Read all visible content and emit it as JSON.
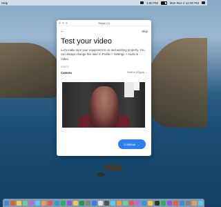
{
  "menubar": {
    "app_name": "Help",
    "status_text": "1:00 PM",
    "clock": "Mon Nov 2 12:00 PM"
  },
  "window": {
    "title": "Skype (1)",
    "skip_label": "Skip",
    "back_icon": "arrow-left-icon",
    "heading": "Test your video",
    "description": "Let's make sure your equipment is on and working properly. You can always change this later in Profile > Settings > Audio & Video.",
    "section_label": "VIDEO",
    "camera_label": "Camera",
    "camera_value": "Built-in (iSight)",
    "continue_label": "Continue",
    "continue_icon": "arrow-right-icon",
    "accent_color": "#2f7ff0"
  },
  "dock": {
    "icon_colors": [
      "#3a8ee6",
      "#e85d3a",
      "#f2c94c",
      "#6fcf97",
      "#bb6bd9",
      "#56ccf2",
      "#f2994a",
      "#eb5757",
      "#2d9cdb",
      "#27ae60",
      "#9b51e0",
      "#f2c94c",
      "#219653",
      "#828282",
      "#2f80ed",
      "#e0e0e0",
      "#4f4f4f",
      "#56ccf2",
      "#f2994a",
      "#6fcf97",
      "#eb5757",
      "#bb6bd9",
      "#2d9cdb",
      "#f2c94c",
      "#333333",
      "#27ae60",
      "#9b51e0",
      "#e85d3a",
      "#3a8ee6",
      "#828282",
      "#f2994a",
      "#56ccf2"
    ]
  }
}
